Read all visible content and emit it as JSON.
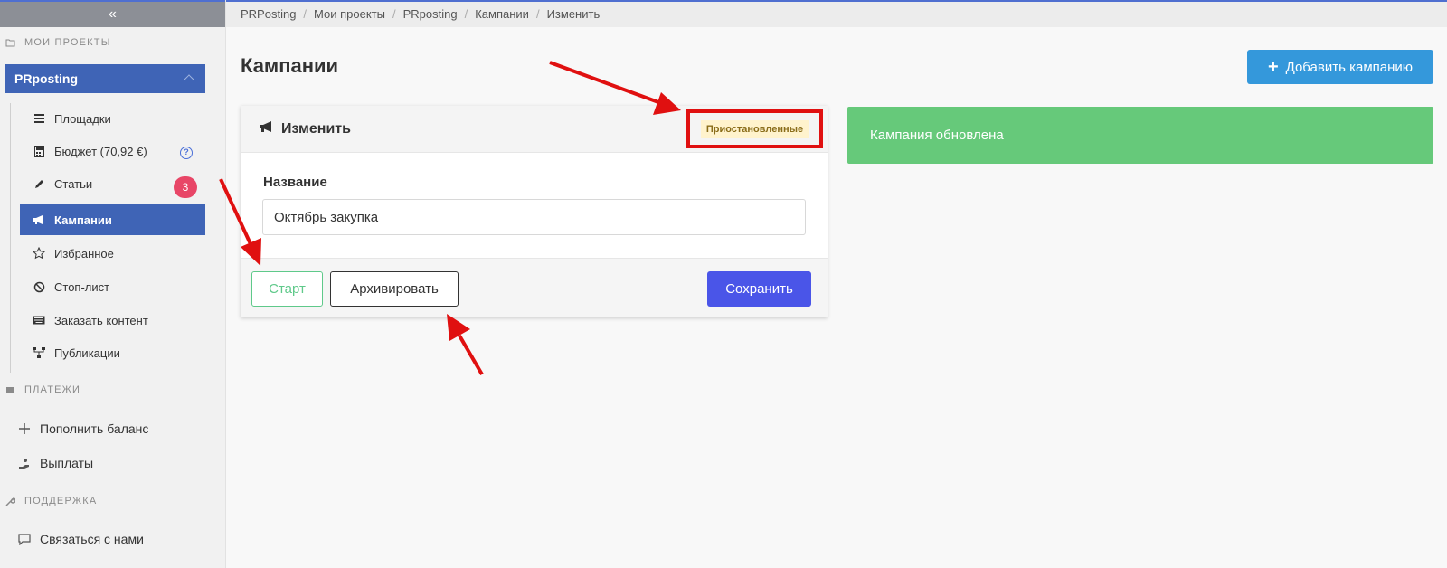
{
  "sidebar": {
    "collapse_glyph": "«",
    "section_projects": "МОИ ПРОЕКТЫ",
    "project_name": "PRposting",
    "items": [
      {
        "label": "Площадки",
        "icon": "list-icon"
      },
      {
        "label": "Бюджет (70,92 €)",
        "icon": "calculator-icon"
      },
      {
        "label": "Статьи",
        "icon": "pencil-icon",
        "badge": "3"
      },
      {
        "label": "Кампании",
        "icon": "megaphone-icon",
        "active": true
      },
      {
        "label": "Избранное",
        "icon": "star-icon"
      },
      {
        "label": "Стоп-лист",
        "icon": "ban-icon"
      },
      {
        "label": "Заказать контент",
        "icon": "keyboard-icon"
      },
      {
        "label": "Публикации",
        "icon": "sitemap-icon"
      }
    ],
    "help_glyph": "?",
    "section_payments": "ПЛАТЕЖИ",
    "topup": "Пополнить баланс",
    "payouts": "Выплаты",
    "section_support": "ПОДДЕРЖКА",
    "contact": "Связаться с нами"
  },
  "breadcrumb": [
    "PRPosting",
    "Мои проекты",
    "PRposting",
    "Кампании",
    "Изменить"
  ],
  "breadcrumb_sep": "/",
  "page": {
    "title": "Кампании",
    "add_button": "Добавить кампанию",
    "add_glyph": "+"
  },
  "card": {
    "title": "Изменить",
    "status": "Приостановленные",
    "field_label": "Название",
    "field_value": "Октябрь закупка",
    "start_button": "Старт",
    "archive_button": "Архивировать",
    "save_button": "Сохранить"
  },
  "alert": {
    "text": "Кампания обновлена"
  },
  "colors": {
    "sidebar_active": "#3f64b6",
    "primary_button": "#3498db",
    "save_button": "#4a55e8",
    "success_alert": "#66c97a",
    "start_outline": "#5fc98a",
    "annotation_red": "#e01010",
    "badge_red": "#e84667"
  }
}
